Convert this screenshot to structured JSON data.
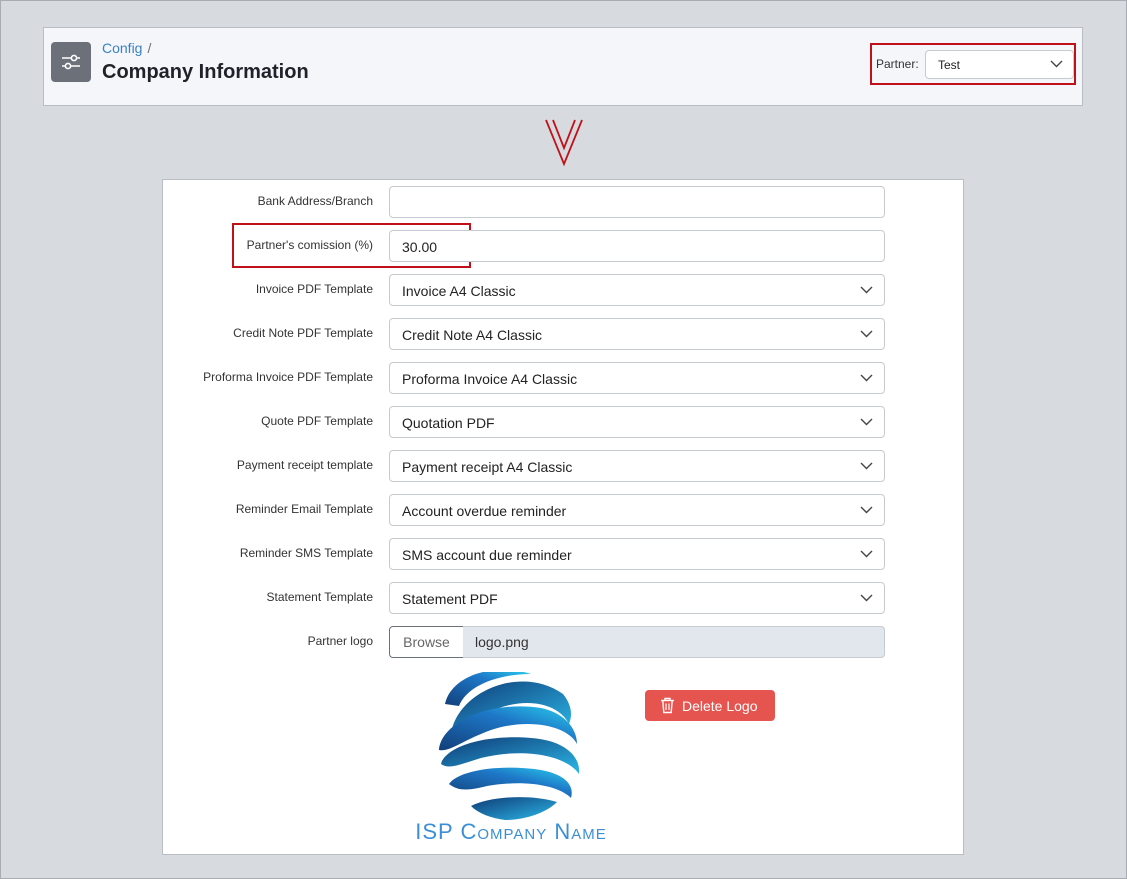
{
  "header": {
    "breadcrumb": "Config",
    "breadcrumb_separator": "/",
    "title": "Company Information",
    "partner_label": "Partner:",
    "partner_value": "Test",
    "icon": "sliders-icon"
  },
  "form": {
    "rows": [
      {
        "label": "Bank Address/Branch",
        "value": "",
        "type": "text"
      },
      {
        "label": "Partner's comission (%)",
        "value": "30.00",
        "type": "text"
      },
      {
        "label": "Invoice PDF Template",
        "value": "Invoice A4 Classic",
        "type": "select"
      },
      {
        "label": "Credit Note PDF Template",
        "value": "Credit Note A4 Classic",
        "type": "select"
      },
      {
        "label": "Proforma Invoice PDF Template",
        "value": "Proforma Invoice A4 Classic",
        "type": "select"
      },
      {
        "label": "Quote PDF Template",
        "value": "Quotation PDF",
        "type": "select"
      },
      {
        "label": "Payment receipt template",
        "value": "Payment receipt A4 Classic",
        "type": "select"
      },
      {
        "label": "Reminder Email Template",
        "value": "Account overdue reminder",
        "type": "select"
      },
      {
        "label": "Reminder SMS Template",
        "value": "SMS account due reminder",
        "type": "select"
      },
      {
        "label": "Statement Template",
        "value": "Statement PDF",
        "type": "select"
      }
    ],
    "logo": {
      "label": "Partner logo",
      "browse_label": "Browse",
      "file_name": "logo.png",
      "logo_text": "ISP Company Name",
      "delete_label": "Delete Logo"
    }
  },
  "colors": {
    "highlight": "#c0101a",
    "link": "#3b82c4",
    "delete": "#e5544f",
    "logo_text": "#3b8fd6"
  }
}
